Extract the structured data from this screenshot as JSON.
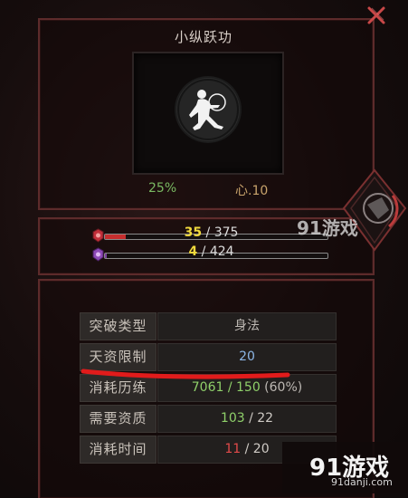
{
  "skill": {
    "title": "小纵跃功",
    "progress_percent": "25%",
    "mind_level": "心.10"
  },
  "bars": [
    {
      "current": "35",
      "separator": " / ",
      "max": "375",
      "fill": 0.093,
      "color": "#c62e2e"
    },
    {
      "current": "4",
      "separator": " / ",
      "max": "424",
      "fill": 0.01,
      "color": "#7a3fa1"
    }
  ],
  "table": [
    {
      "label": "突破类型",
      "value": "身法",
      "value_class": "grey"
    },
    {
      "label": "天资限制",
      "value": "20",
      "value_class": "blue"
    },
    {
      "label": "消耗历练",
      "value_main": "7061 / 150",
      "value_extra": " (60%)",
      "value_class": "green"
    },
    {
      "label": "需要资质",
      "value_main": "103",
      "value_rest": " / 22",
      "value_class": "green"
    },
    {
      "label": "消耗时间",
      "value_main": "11",
      "value_rest": " / 20",
      "value_class": "red"
    }
  ],
  "watermarks": {
    "logo_small": "91游戏",
    "logo_big": "91游戏",
    "logo_url": "91danji.com"
  },
  "icons": [
    "close-icon",
    "skill-figure-icon",
    "blood-badge-icon",
    "spirit-badge-icon",
    "shield-emblem-icon"
  ],
  "colors": {
    "frame": "#5d2b2b",
    "accent_yellow": "#f0d93d",
    "green": "#8fd06a",
    "red": "#e24a4a",
    "blue": "#8db6e6"
  }
}
